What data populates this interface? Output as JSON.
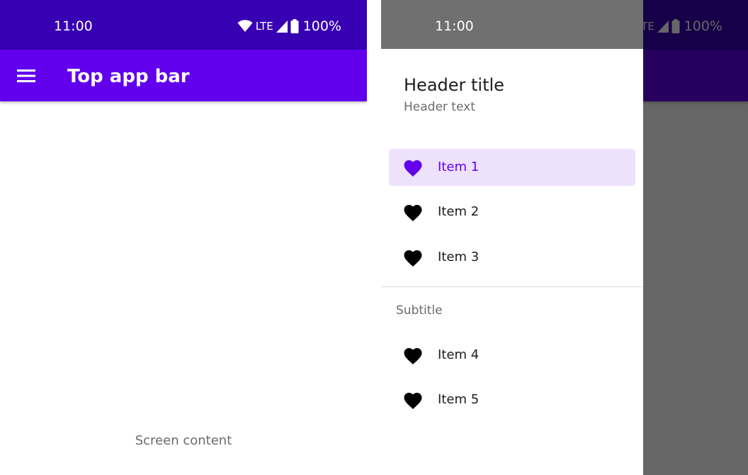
{
  "status_bar": {
    "time": "11:00",
    "network_label": "LTE",
    "battery_percent": "100%"
  },
  "top_app_bar": {
    "title": "Top app bar",
    "nav_icon": "menu-icon"
  },
  "screen": {
    "content_text": "Screen content"
  },
  "drawer": {
    "header_title": "Header title",
    "header_text": "Header text",
    "items": [
      {
        "label": "Item 1",
        "icon": "heart-icon",
        "selected": true
      },
      {
        "label": "Item 2",
        "icon": "heart-icon",
        "selected": false
      },
      {
        "label": "Item 3",
        "icon": "heart-icon",
        "selected": false
      }
    ],
    "section_subtitle": "Subtitle",
    "section_items": [
      {
        "label": "Item 4",
        "icon": "heart-icon",
        "selected": false
      },
      {
        "label": "Item 5",
        "icon": "heart-icon",
        "selected": false
      }
    ]
  },
  "colors": {
    "primary": "#6200ee",
    "primary_variant": "#3700b3",
    "selected_item_background": "#ede1fc",
    "on_surface": "#1d1d1d",
    "scrim": "rgba(0,0,0,0.6)"
  }
}
